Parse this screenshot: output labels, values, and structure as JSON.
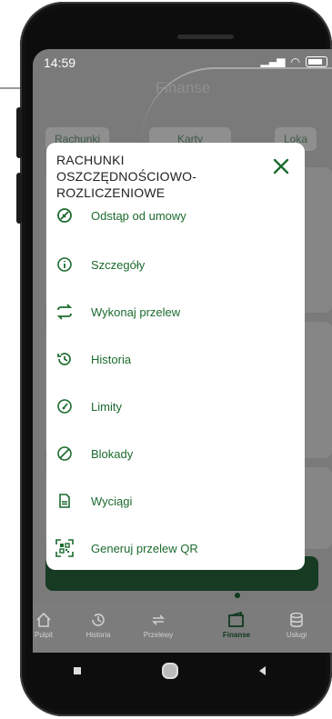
{
  "status": {
    "time": "14:59"
  },
  "app": {
    "title": "Finanse"
  },
  "tabs": [
    "Rachunki",
    "Karty",
    "Loka"
  ],
  "modal": {
    "title": "RACHUNKI OSZCZĘDNOŚCIOWO-ROZLICZENIOWE",
    "items": [
      {
        "label": "Odstąp od umowy",
        "icon": "withdraw-icon"
      },
      {
        "label": "Szczegóły",
        "icon": "info-icon"
      },
      {
        "label": "Wykonaj przelew",
        "icon": "transfer-icon"
      },
      {
        "label": "Historia",
        "icon": "history-icon"
      },
      {
        "label": "Limity",
        "icon": "gauge-icon"
      },
      {
        "label": "Blokady",
        "icon": "block-icon"
      },
      {
        "label": "Wyciągi",
        "icon": "document-icon"
      },
      {
        "label": "Generuj przelew QR",
        "icon": "qr-code-icon"
      }
    ]
  },
  "nav": [
    {
      "label": "Pulpit",
      "icon": "home-icon"
    },
    {
      "label": "Historia",
      "icon": "history-icon"
    },
    {
      "label": "Przelewy",
      "icon": "transfer-icon"
    },
    {
      "label": "Finanse",
      "icon": "wallet-icon"
    },
    {
      "label": "Usługi",
      "icon": "database-icon"
    }
  ],
  "colors": {
    "accent": "#1b6b2e",
    "dark_green": "#0f3a1e"
  }
}
